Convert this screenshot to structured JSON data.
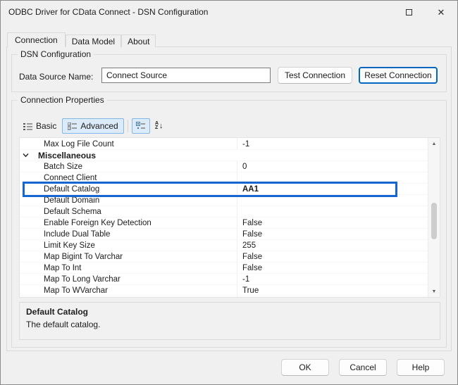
{
  "window": {
    "title": "ODBC Driver for CData Connect - DSN Configuration"
  },
  "icons": {
    "maximize": "maximize-square",
    "close": "✕",
    "basic": "form-lines",
    "advanced": "form-lines",
    "categorized": "category-boxes",
    "sort_az": "A-Z-down-arrow",
    "category_chevron": "chevron-down",
    "scroll_up": "▲",
    "scroll_down": "▼"
  },
  "tabs": [
    {
      "label": "Connection",
      "active": true
    },
    {
      "label": "Data Model",
      "active": false
    },
    {
      "label": "About",
      "active": false
    }
  ],
  "dsn": {
    "group_title": "DSN Configuration",
    "name_label": "Data Source Name:",
    "name_value": "Connect Source",
    "test_button": "Test Connection",
    "reset_button": "Reset Connection"
  },
  "props": {
    "group_title": "Connection Properties",
    "toolbar": {
      "basic": "Basic",
      "advanced": "Advanced"
    },
    "grid": {
      "rows": [
        {
          "type": "prop",
          "name": "Max Log File Count",
          "value": "-1"
        },
        {
          "type": "category",
          "name": "Miscellaneous",
          "value": ""
        },
        {
          "type": "prop",
          "name": "Batch Size",
          "value": "0"
        },
        {
          "type": "prop",
          "name": "Connect Client",
          "value": ""
        },
        {
          "type": "prop",
          "name": "Default Catalog",
          "value": "AA1",
          "highlight": true
        },
        {
          "type": "prop",
          "name": "Default Domain",
          "value": ""
        },
        {
          "type": "prop",
          "name": "Default Schema",
          "value": ""
        },
        {
          "type": "prop",
          "name": "Enable Foreign Key Detection",
          "value": "False"
        },
        {
          "type": "prop",
          "name": "Include Dual Table",
          "value": "False"
        },
        {
          "type": "prop",
          "name": "Limit Key Size",
          "value": "255"
        },
        {
          "type": "prop",
          "name": "Map Bigint To Varchar",
          "value": "False"
        },
        {
          "type": "prop",
          "name": "Map To Int",
          "value": "False"
        },
        {
          "type": "prop",
          "name": "Map To Long Varchar",
          "value": "-1"
        },
        {
          "type": "prop",
          "name": "Map To WVarchar",
          "value": "True"
        }
      ]
    },
    "description": {
      "title": "Default Catalog",
      "text": "The default catalog."
    }
  },
  "footer": {
    "ok": "OK",
    "cancel": "Cancel",
    "help": "Help"
  },
  "colors": {
    "accent": "#0067c0",
    "highlight_box": "#1566d0",
    "toolbar_selected_bg": "#dcebf9",
    "toolbar_selected_border": "#84b8e6"
  }
}
